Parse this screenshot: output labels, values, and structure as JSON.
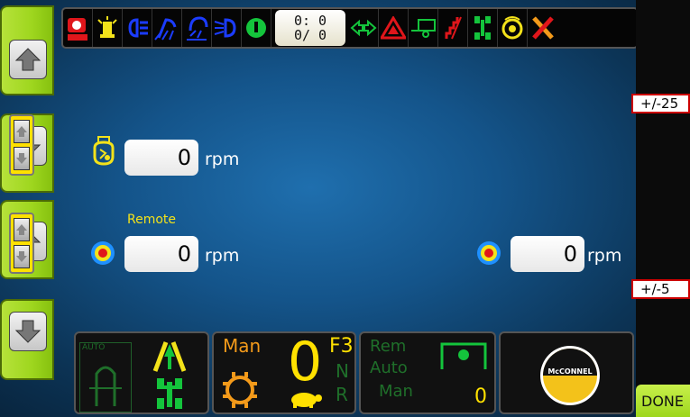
{
  "status_bar": {
    "icons": [
      "engine-unit-icon",
      "beacon-light-icon",
      "headlight-icon",
      "work-light-front-icon",
      "work-light-rear-icon",
      "rear-light-icon",
      "green-indicator-icon",
      "turn-signal-icon",
      "hazard-icon",
      "trailer-icon",
      "stairs-icon",
      "axle-icon",
      "power-takeoff-icon",
      "fault-tools-icon"
    ],
    "counter": {
      "line1": "0: 0",
      "line2": "0/ 0"
    }
  },
  "right_panel": {
    "step_top": "+/-25",
    "step_bottom": "+/-5",
    "done_label": "DONE"
  },
  "main": {
    "row1": {
      "value": "0",
      "unit": "rpm",
      "icon": "engine-speed-icon"
    },
    "row2": {
      "header": "Remote",
      "value": "0",
      "unit": "rpm",
      "icon": "target-icon"
    },
    "row3": {
      "value": "0",
      "unit": "rpm",
      "icon": "target-icon"
    }
  },
  "bottom": {
    "panel1": {
      "auto_label": "AUTO"
    },
    "panel2": {
      "mode": "Man",
      "speed": "0",
      "gear": "F3",
      "neutral": "N",
      "reverse": "R"
    },
    "panel3": {
      "rem": "Rem",
      "auto": "Auto",
      "man": "Man",
      "value": "0"
    },
    "panel4": {
      "logo_text": "McCONNEL"
    }
  },
  "colors": {
    "accent_green": "#9ed61e",
    "indicator_yellow": "#ffe100",
    "panel_green": "#1f9a3a",
    "red": "#e0161b",
    "blue": "#1b3cff"
  }
}
